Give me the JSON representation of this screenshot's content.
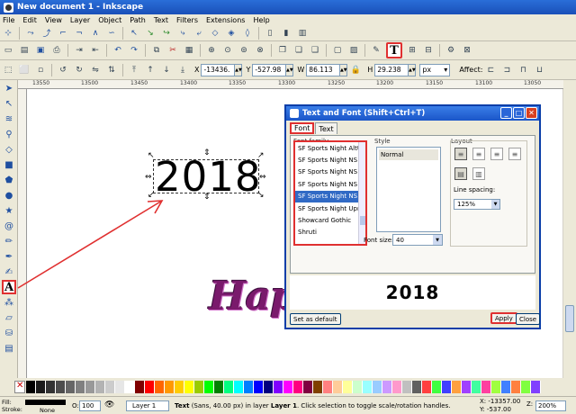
{
  "window": {
    "title": "New document 1 - Inkscape"
  },
  "menu": [
    "File",
    "Edit",
    "View",
    "Layer",
    "Object",
    "Path",
    "Text",
    "Filters",
    "Extensions",
    "Help"
  ],
  "toolbar_controls": {
    "x_label": "X",
    "x_value": "-13436.",
    "y_label": "Y",
    "y_value": "-527.98",
    "w_label": "W",
    "w_value": "86.113",
    "h_label": "H",
    "h_value": "29.238",
    "unit": "px",
    "affect_label": "Affect:"
  },
  "rulers": {
    "top_ticks": [
      "13550",
      "13500",
      "13450",
      "13400",
      "13350",
      "13300",
      "13250",
      "13200",
      "13150",
      "13100",
      "13050"
    ]
  },
  "canvas": {
    "selected_text": "2018",
    "script_text": "Happy"
  },
  "dialog": {
    "title": "Text and Font (Shift+Ctrl+T)",
    "tabs": [
      "Font",
      "Text"
    ],
    "font_family_label": "Font family",
    "font_families": [
      "SF Sports Night AltU",
      "SF Sports Night NS",
      "SF Sports Night NS A",
      "SF Sports Night NS A",
      "SF Sports Night NS U",
      "SF Sports Night Upri",
      "Showcard Gothic",
      "Shruti"
    ],
    "selected_index": 4,
    "style_label": "Style",
    "styles": [
      "Normal"
    ],
    "font_size_label": "Font size:",
    "font_size": "40",
    "layout_label": "Layout",
    "line_spacing_label": "Line spacing:",
    "line_spacing": "125%",
    "preview_text": "2018",
    "set_default_label": "Set as default",
    "apply_label": "Apply",
    "close_label": "Close"
  },
  "palette": [
    "#000000",
    "#1a1a1a",
    "#333333",
    "#4d4d4d",
    "#666666",
    "#808080",
    "#999999",
    "#b3b3b3",
    "#cccccc",
    "#e6e6e6",
    "#ffffff",
    "#800000",
    "#ff0000",
    "#ff6600",
    "#ff9900",
    "#ffcc00",
    "#ffff00",
    "#99cc00",
    "#00ff00",
    "#008000",
    "#00ff80",
    "#00ffff",
    "#0080ff",
    "#0000ff",
    "#000080",
    "#8000ff",
    "#ff00ff",
    "#ff0080",
    "#800040",
    "#804000",
    "#ff8080",
    "#ffcc99",
    "#ffff99",
    "#ccffcc",
    "#99ffff",
    "#99ccff",
    "#cc99ff",
    "#ff99cc",
    "#c0c0c0",
    "#606060",
    "#ff4040",
    "#40ff40",
    "#4040ff",
    "#ffa040",
    "#a040ff",
    "#40ffa0",
    "#ff40a0",
    "#a0ff40",
    "#4080ff",
    "#ff8040",
    "#80ff40",
    "#8040ff"
  ],
  "status": {
    "fill_label": "Fill:",
    "stroke_label": "Stroke:",
    "stroke_value": "None",
    "opacity_label": "O:",
    "opacity_value": "100",
    "layer_value": "Layer 1",
    "message_bold": "Text",
    "message_rest": " (Sans, 40.00 px) in layer ",
    "message_layer": "Layer 1",
    "message_tail": ". Click selection to toggle scale/rotation handles.",
    "x_coord": "X: -13357.00",
    "y_coord": "Y: -537.00",
    "zoom_label": "Z:",
    "zoom_value": "200%"
  }
}
